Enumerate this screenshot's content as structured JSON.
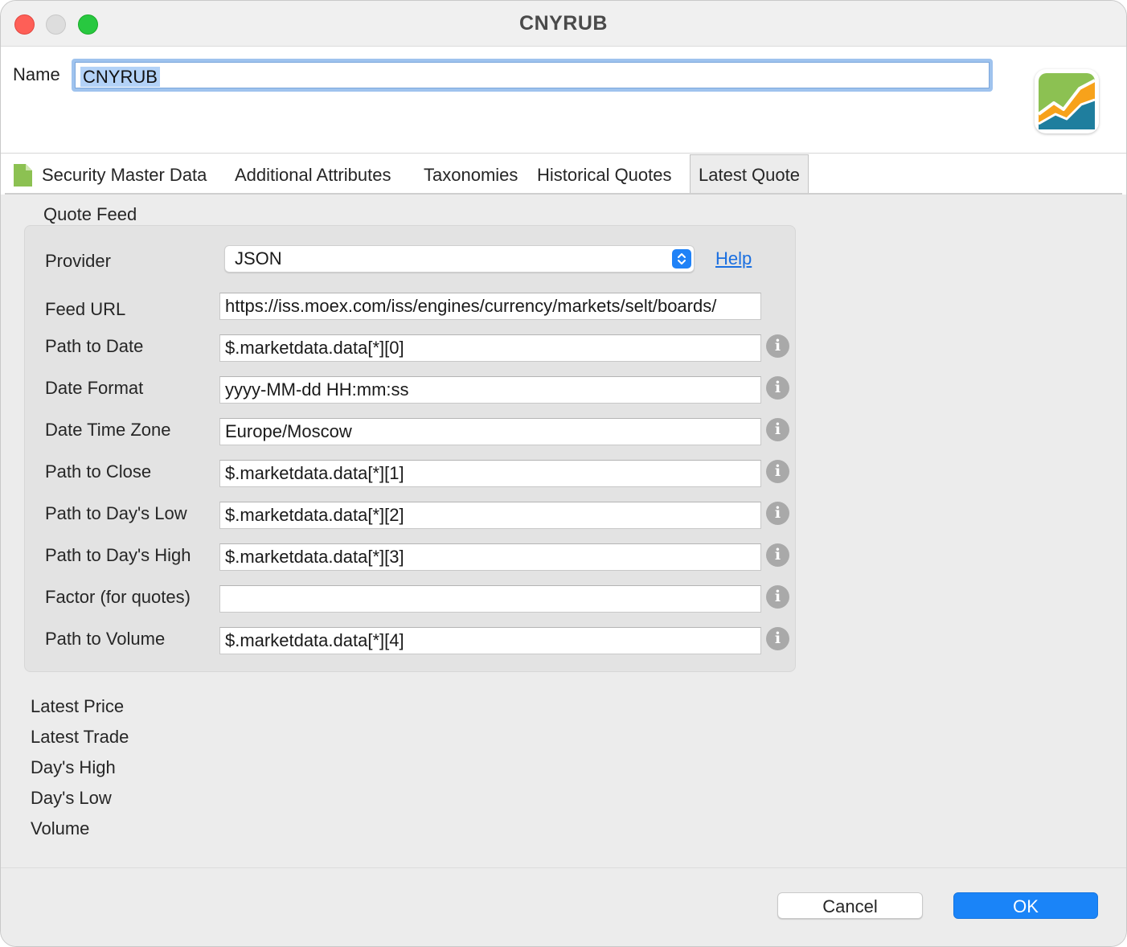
{
  "window": {
    "title": "CNYRUB"
  },
  "header": {
    "name_label": "Name",
    "name_value": "CNYRUB"
  },
  "tabs": [
    {
      "label": "Security Master Data"
    },
    {
      "label": "Additional Attributes"
    },
    {
      "label": "Taxonomies"
    },
    {
      "label": "Historical Quotes"
    },
    {
      "label": "Latest Quote",
      "active": true
    }
  ],
  "quote_feed": {
    "title": "Quote Feed",
    "provider_label": "Provider",
    "provider_value": "JSON",
    "help_label": "Help",
    "fields": [
      {
        "label": "Feed URL",
        "value": "https://iss.moex.com/iss/engines/currency/markets/selt/boards/"
      },
      {
        "label": "Path to Date",
        "value": "$.marketdata.data[*][0]"
      },
      {
        "label": "Date Format",
        "value": "yyyy-MM-dd HH:mm:ss"
      },
      {
        "label": "Date Time Zone",
        "value": "Europe/Moscow"
      },
      {
        "label": "Path to Close",
        "value": "$.marketdata.data[*][1]"
      },
      {
        "label": "Path to Day's Low",
        "value": "$.marketdata.data[*][2]"
      },
      {
        "label": "Path to Day's High",
        "value": "$.marketdata.data[*][3]"
      },
      {
        "label": "Factor (for quotes)",
        "value": ""
      },
      {
        "label": "Path to Volume",
        "value": "$.marketdata.data[*][4]"
      }
    ],
    "info_glyph": "i"
  },
  "summary": [
    "Latest Price",
    "Latest Trade",
    "Day's High",
    "Day's Low",
    "Volume"
  ],
  "footer": {
    "cancel_label": "Cancel",
    "ok_label": "OK"
  },
  "colors": {
    "accent": "#1a84f8",
    "link": "#1a6fe0",
    "name_focus": "#9fc3ee"
  }
}
